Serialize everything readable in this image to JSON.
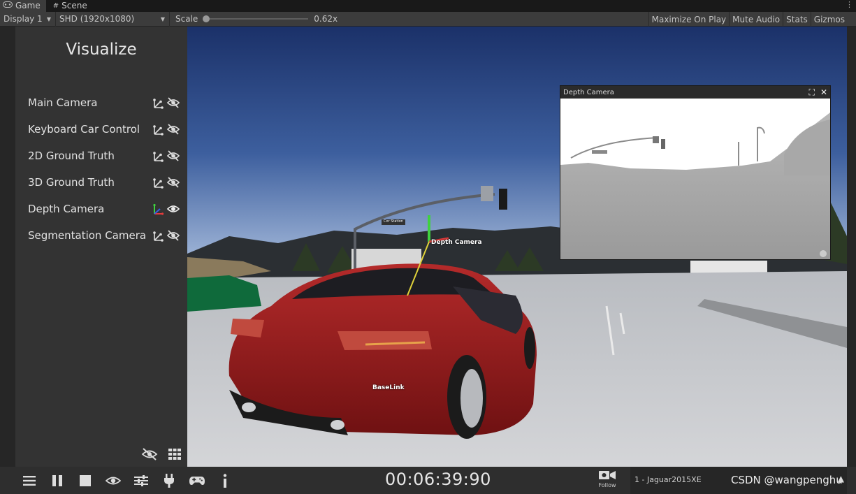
{
  "tabs": [
    {
      "label": "Game",
      "icon": "gamepad-icon",
      "active": true
    },
    {
      "label": "Scene",
      "icon": "grid-icon",
      "active": false
    }
  ],
  "toolbar": {
    "display": "Display 1",
    "resolution": "SHD (1920x1080)",
    "scale_label": "Scale",
    "scale_value": "0.62x",
    "scale_level": 0.0,
    "buttons": [
      "Maximize On Play",
      "Mute Audio",
      "Stats",
      "Gizmos"
    ]
  },
  "visualize": {
    "title": "Visualize",
    "items": [
      {
        "label": "Main Camera",
        "visible": false
      },
      {
        "label": "Keyboard Car Control",
        "visible": false
      },
      {
        "label": "2D Ground Truth",
        "visible": false
      },
      {
        "label": "3D Ground Truth",
        "visible": false
      },
      {
        "label": "Depth Camera",
        "visible": true
      },
      {
        "label": "Segmentation Camera",
        "visible": false
      }
    ]
  },
  "scene": {
    "label_depth_camera": "Depth Camera",
    "label_baselink": "BaseLink",
    "street_sign": "Cor Station"
  },
  "depth_window": {
    "title": "Depth Camera"
  },
  "bottom": {
    "timer": "00:06:39:90",
    "follow_label": "Follow",
    "vehicle": "1 - Jaguar2015XE",
    "watermark": "CSDN @wangpenghu"
  },
  "colors": {
    "panel": "#333333",
    "bar": "#2e2e2e",
    "car": "#9b1b1c",
    "sky_top": "#1d3670",
    "sky_bottom": "#7f9ec9"
  }
}
